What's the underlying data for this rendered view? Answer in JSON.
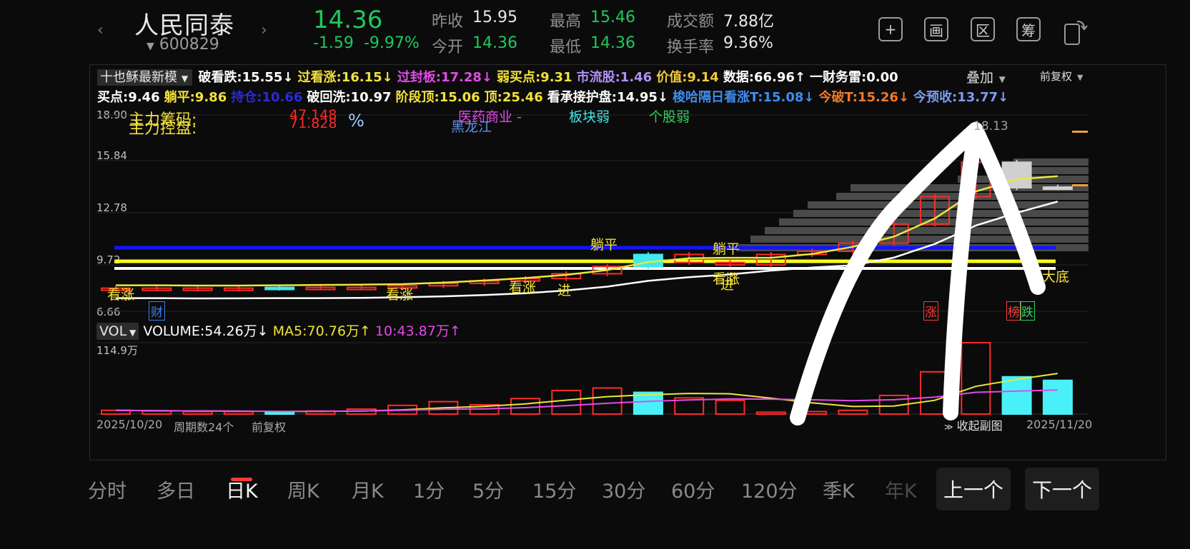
{
  "header": {
    "name": "人民同泰",
    "code": "600829",
    "price": "14.36",
    "change": "-1.59",
    "change_pct": "-9.97%",
    "quote": {
      "prev_close_label": "昨收",
      "prev_close": "15.95",
      "open_label": "今开",
      "open": "14.36",
      "high_label": "最高",
      "high": "15.46",
      "low_label": "最低",
      "low": "14.36",
      "amount_label": "成交额",
      "amount": "7.88亿",
      "turnover_label": "换手率",
      "turnover": "9.36%"
    },
    "tools": [
      "+",
      "画",
      "区",
      "筹"
    ]
  },
  "indicators": {
    "selector": "十也稣最新模",
    "row1": [
      {
        "label": "破看跌:",
        "value": "15.55↓",
        "color": "#ffffff"
      },
      {
        "label": "过看涨:",
        "value": "16.15↓",
        "color": "#f2e23a"
      },
      {
        "label": "过封板:",
        "value": "17.28↓",
        "color": "#e24be8"
      },
      {
        "label": "弱买点:",
        "value": "9.31",
        "color": "#f2e23a"
      },
      {
        "label": "市流股:",
        "value": "1.46",
        "color": "#b08ff5"
      },
      {
        "label": "价值:",
        "value": "9.14",
        "color": "#f2c83a"
      },
      {
        "label": "数据:",
        "value": "66.96↑",
        "color": "#ffffff"
      },
      {
        "label": "一财务雷:",
        "value": "0.00",
        "color": "#ffffff"
      }
    ],
    "overlay": "叠加",
    "adjust": "前复权",
    "row2": [
      {
        "label": "买点:",
        "value": "9.46",
        "color": "#ffffff"
      },
      {
        "label": "躺平:",
        "value": "9.86",
        "color": "#f2e23a"
      },
      {
        "label": "持仓:",
        "value": "10.66",
        "color": "#2a2ad8"
      },
      {
        "label": "破回洗:",
        "value": "10.97",
        "color": "#ffffff"
      },
      {
        "label": "阶段顶:",
        "value": "15.06",
        "color": "#f2e23a"
      },
      {
        "label": "顶:",
        "value": "25.46",
        "color": "#f2e23a"
      },
      {
        "label": "看承接护盘:",
        "value": "14.95↓",
        "color": "#ffffff"
      },
      {
        "label": "梭哈隔日看涨T:",
        "value": "15.08↓",
        "color": "#3f8df0"
      },
      {
        "label": "今破T:",
        "value": "15.26↓",
        "color": "#f07a2a"
      },
      {
        "label": "今预收:",
        "value": "13.77↓",
        "color": "#7d9df0"
      }
    ]
  },
  "chart_labels": {
    "y_ticks": [
      "18.90",
      "15.84",
      "12.78",
      "9.72",
      "6.66"
    ],
    "main_a": "主力筹码:",
    "main_b": "主力控盘:",
    "val_a": "47.148",
    "val_b": "71.828",
    "pct": "%",
    "sector": "医药商业 -",
    "sector_b": "黑龙江",
    "sector_weak": "板块弱",
    "stock_weak": "个股弱",
    "peak": "18.13",
    "marks": [
      "看涨",
      "财",
      "看涨",
      "看涨",
      "进",
      "躺平",
      "躺平",
      "看涨",
      "进",
      "涨",
      "榜",
      "跌",
      "大底"
    ]
  },
  "chart_data": {
    "type": "candlestick",
    "dates_shown": [
      "2025/10/20",
      "2025/11/20"
    ],
    "ylim": [
      6.66,
      18.9
    ],
    "close": [
      8.1,
      8.1,
      8.05,
      8.1,
      8.15,
      8.12,
      8.15,
      8.25,
      8.4,
      8.55,
      8.7,
      9.0,
      9.45,
      10.2,
      9.7,
      9.55,
      10.2,
      10.4,
      10.9,
      12.1,
      13.8,
      15.95,
      14.36,
      14.4
    ],
    "volume_wan": [
      6,
      5,
      4,
      4,
      3,
      5,
      8,
      14,
      20,
      15,
      25,
      38,
      42,
      35,
      26,
      22,
      3,
      4,
      6,
      30,
      68,
      114.9,
      60,
      54.26
    ],
    "up": [
      true,
      true,
      true,
      true,
      false,
      true,
      true,
      true,
      true,
      true,
      true,
      true,
      true,
      false,
      true,
      true,
      true,
      true,
      true,
      true,
      true,
      true,
      false,
      false
    ]
  },
  "volume": {
    "selector": "VOL",
    "volume": "VOLUME:54.26万↓",
    "ma5": "MA5:70.76万↑",
    "ma10": "10:43.87万↑",
    "max": "114.9万"
  },
  "footer": {
    "start_date": "2025/10/20",
    "cycles": "周期数24个",
    "adjust": "前复权",
    "collapse": "收起副图",
    "end_date": "2025/11/20"
  },
  "periods": [
    "分时",
    "多日",
    "日K",
    "周K",
    "月K",
    "1分",
    "5分",
    "15分",
    "30分",
    "60分",
    "120分",
    "季K",
    "年K"
  ],
  "prev_btn": "上一个",
  "next_btn": "下一个"
}
